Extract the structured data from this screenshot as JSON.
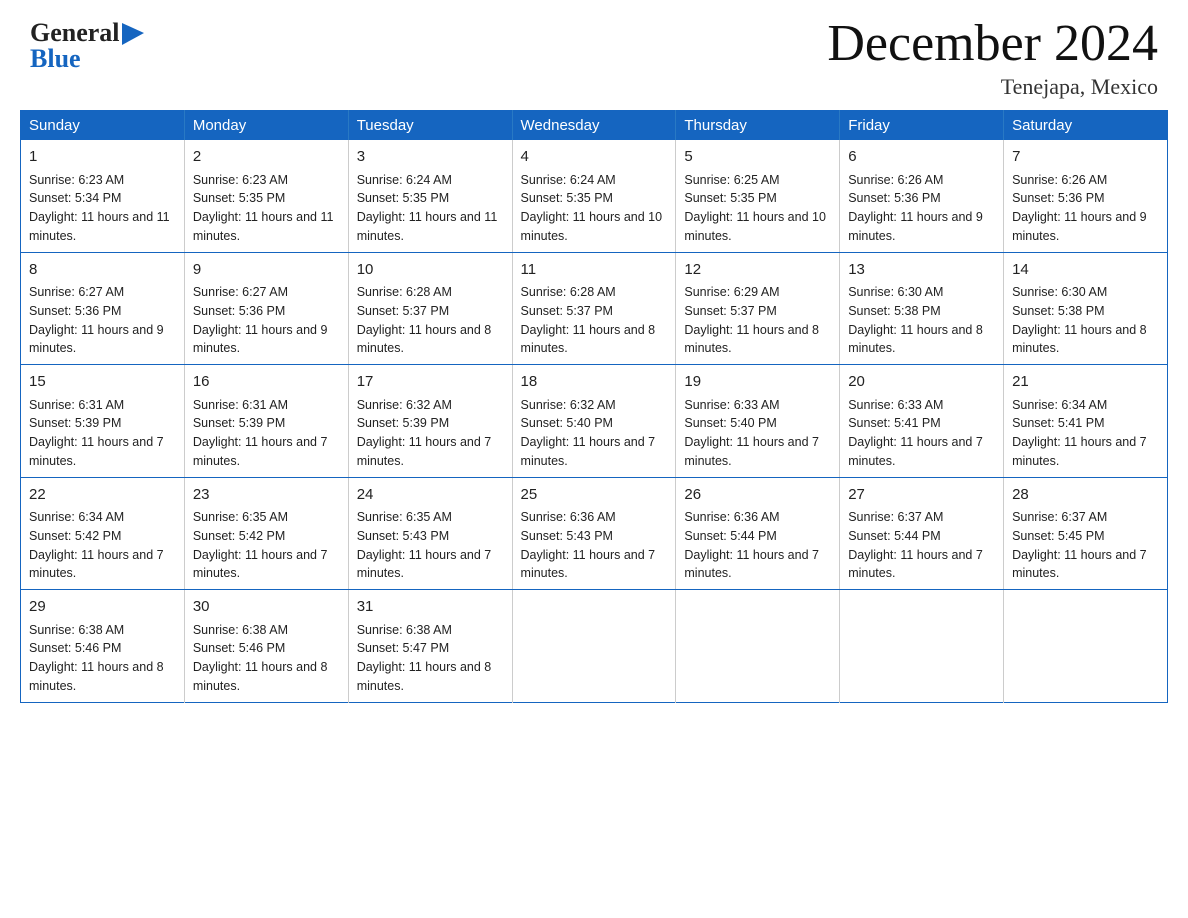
{
  "logo": {
    "general": "General",
    "blue": "Blue",
    "arrow": "▶"
  },
  "title": "December 2024",
  "location": "Tenejapa, Mexico",
  "days_of_week": [
    "Sunday",
    "Monday",
    "Tuesday",
    "Wednesday",
    "Thursday",
    "Friday",
    "Saturday"
  ],
  "weeks": [
    [
      {
        "day": "1",
        "sunrise": "6:23 AM",
        "sunset": "5:34 PM",
        "daylight": "11 hours and 11 minutes."
      },
      {
        "day": "2",
        "sunrise": "6:23 AM",
        "sunset": "5:35 PM",
        "daylight": "11 hours and 11 minutes."
      },
      {
        "day": "3",
        "sunrise": "6:24 AM",
        "sunset": "5:35 PM",
        "daylight": "11 hours and 11 minutes."
      },
      {
        "day": "4",
        "sunrise": "6:24 AM",
        "sunset": "5:35 PM",
        "daylight": "11 hours and 10 minutes."
      },
      {
        "day": "5",
        "sunrise": "6:25 AM",
        "sunset": "5:35 PM",
        "daylight": "11 hours and 10 minutes."
      },
      {
        "day": "6",
        "sunrise": "6:26 AM",
        "sunset": "5:36 PM",
        "daylight": "11 hours and 9 minutes."
      },
      {
        "day": "7",
        "sunrise": "6:26 AM",
        "sunset": "5:36 PM",
        "daylight": "11 hours and 9 minutes."
      }
    ],
    [
      {
        "day": "8",
        "sunrise": "6:27 AM",
        "sunset": "5:36 PM",
        "daylight": "11 hours and 9 minutes."
      },
      {
        "day": "9",
        "sunrise": "6:27 AM",
        "sunset": "5:36 PM",
        "daylight": "11 hours and 9 minutes."
      },
      {
        "day": "10",
        "sunrise": "6:28 AM",
        "sunset": "5:37 PM",
        "daylight": "11 hours and 8 minutes."
      },
      {
        "day": "11",
        "sunrise": "6:28 AM",
        "sunset": "5:37 PM",
        "daylight": "11 hours and 8 minutes."
      },
      {
        "day": "12",
        "sunrise": "6:29 AM",
        "sunset": "5:37 PM",
        "daylight": "11 hours and 8 minutes."
      },
      {
        "day": "13",
        "sunrise": "6:30 AM",
        "sunset": "5:38 PM",
        "daylight": "11 hours and 8 minutes."
      },
      {
        "day": "14",
        "sunrise": "6:30 AM",
        "sunset": "5:38 PM",
        "daylight": "11 hours and 8 minutes."
      }
    ],
    [
      {
        "day": "15",
        "sunrise": "6:31 AM",
        "sunset": "5:39 PM",
        "daylight": "11 hours and 7 minutes."
      },
      {
        "day": "16",
        "sunrise": "6:31 AM",
        "sunset": "5:39 PM",
        "daylight": "11 hours and 7 minutes."
      },
      {
        "day": "17",
        "sunrise": "6:32 AM",
        "sunset": "5:39 PM",
        "daylight": "11 hours and 7 minutes."
      },
      {
        "day": "18",
        "sunrise": "6:32 AM",
        "sunset": "5:40 PM",
        "daylight": "11 hours and 7 minutes."
      },
      {
        "day": "19",
        "sunrise": "6:33 AM",
        "sunset": "5:40 PM",
        "daylight": "11 hours and 7 minutes."
      },
      {
        "day": "20",
        "sunrise": "6:33 AM",
        "sunset": "5:41 PM",
        "daylight": "11 hours and 7 minutes."
      },
      {
        "day": "21",
        "sunrise": "6:34 AM",
        "sunset": "5:41 PM",
        "daylight": "11 hours and 7 minutes."
      }
    ],
    [
      {
        "day": "22",
        "sunrise": "6:34 AM",
        "sunset": "5:42 PM",
        "daylight": "11 hours and 7 minutes."
      },
      {
        "day": "23",
        "sunrise": "6:35 AM",
        "sunset": "5:42 PM",
        "daylight": "11 hours and 7 minutes."
      },
      {
        "day": "24",
        "sunrise": "6:35 AM",
        "sunset": "5:43 PM",
        "daylight": "11 hours and 7 minutes."
      },
      {
        "day": "25",
        "sunrise": "6:36 AM",
        "sunset": "5:43 PM",
        "daylight": "11 hours and 7 minutes."
      },
      {
        "day": "26",
        "sunrise": "6:36 AM",
        "sunset": "5:44 PM",
        "daylight": "11 hours and 7 minutes."
      },
      {
        "day": "27",
        "sunrise": "6:37 AM",
        "sunset": "5:44 PM",
        "daylight": "11 hours and 7 minutes."
      },
      {
        "day": "28",
        "sunrise": "6:37 AM",
        "sunset": "5:45 PM",
        "daylight": "11 hours and 7 minutes."
      }
    ],
    [
      {
        "day": "29",
        "sunrise": "6:38 AM",
        "sunset": "5:46 PM",
        "daylight": "11 hours and 8 minutes."
      },
      {
        "day": "30",
        "sunrise": "6:38 AM",
        "sunset": "5:46 PM",
        "daylight": "11 hours and 8 minutes."
      },
      {
        "day": "31",
        "sunrise": "6:38 AM",
        "sunset": "5:47 PM",
        "daylight": "11 hours and 8 minutes."
      },
      null,
      null,
      null,
      null
    ]
  ],
  "labels": {
    "sunrise": "Sunrise:",
    "sunset": "Sunset:",
    "daylight": "Daylight:"
  }
}
